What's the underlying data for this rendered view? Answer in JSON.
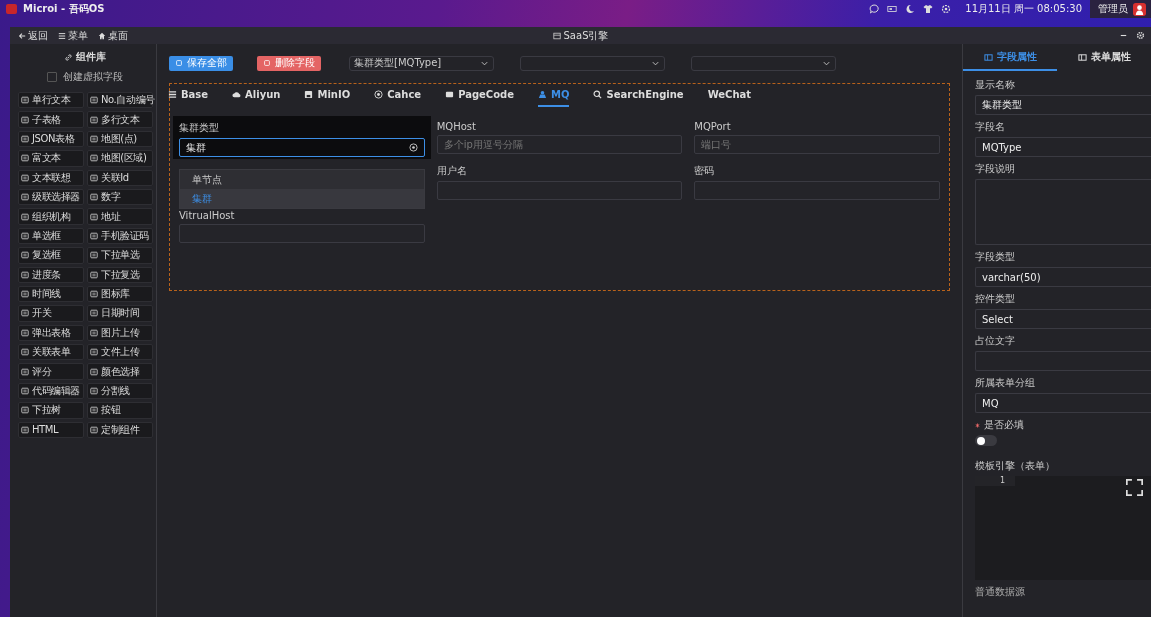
{
  "top_bar": {
    "app_title": "Microi - 吾码OS",
    "clock": "11月11日 周一 08:05:30",
    "user": "管理员"
  },
  "window": {
    "nav": [
      {
        "label": "返回"
      },
      {
        "label": "菜单"
      },
      {
        "label": "桌面"
      }
    ],
    "title": "SaaS引擎"
  },
  "palette": {
    "title": "组件库",
    "virtual_field": {
      "label": "创建虚拟字段",
      "checked": false
    },
    "items": [
      {
        "label": "单行文本"
      },
      {
        "label": "No.自动编号"
      },
      {
        "label": "子表格"
      },
      {
        "label": "多行文本"
      },
      {
        "label": "JSON表格"
      },
      {
        "label": "地图(点)"
      },
      {
        "label": "富文本"
      },
      {
        "label": "地图(区域)"
      },
      {
        "label": "文本联想"
      },
      {
        "label": "关联Id"
      },
      {
        "label": "级联选择器"
      },
      {
        "label": "数字"
      },
      {
        "label": "组织机构"
      },
      {
        "label": "地址"
      },
      {
        "label": "单选框"
      },
      {
        "label": "手机验证码"
      },
      {
        "label": "复选框"
      },
      {
        "label": "下拉单选"
      },
      {
        "label": "进度条"
      },
      {
        "label": "下拉复选"
      },
      {
        "label": "时间线"
      },
      {
        "label": "图标库"
      },
      {
        "label": "开关"
      },
      {
        "label": "日期时间"
      },
      {
        "label": "弹出表格"
      },
      {
        "label": "图片上传"
      },
      {
        "label": "关联表单"
      },
      {
        "label": "文件上传"
      },
      {
        "label": "评分"
      },
      {
        "label": "颜色选择"
      },
      {
        "label": "代码编辑器"
      },
      {
        "label": "分割线"
      },
      {
        "label": "下拉树"
      },
      {
        "label": "按钮"
      },
      {
        "label": "HTML"
      },
      {
        "label": "定制组件"
      }
    ]
  },
  "toolbar": {
    "buttons": [
      {
        "label": "保存全部",
        "kind": "primary"
      },
      {
        "label": "删除字段",
        "kind": "danger"
      }
    ],
    "selects": [
      {
        "kind": "select",
        "value": "集群类型[MQType]"
      },
      {
        "kind": "select"
      },
      {
        "kind": "select"
      }
    ]
  },
  "form": {
    "tabs": [
      {
        "label": "Base",
        "selected": false
      },
      {
        "label": "Aliyun",
        "selected": false
      },
      {
        "label": "MinIO",
        "selected": false
      },
      {
        "label": "Cahce",
        "selected": false
      },
      {
        "label": "PageCode",
        "selected": false
      },
      {
        "label": "MQ",
        "selected": true
      },
      {
        "label": "SearchEngine",
        "selected": false
      },
      {
        "label": "WeChat",
        "selected": false
      }
    ],
    "fields": [
      {
        "label": "集群类型",
        "kind": "select",
        "value": "集群",
        "focused": true,
        "expanded": true,
        "options": [
          {
            "label": "单节点",
            "selected": false
          },
          {
            "label": "集群",
            "selected": true
          }
        ]
      },
      {
        "label": "MQHost",
        "kind": "input",
        "placeholder": "多个ip用逗号分隔"
      },
      {
        "label": "MQPort",
        "kind": "input",
        "placeholder": "端口号"
      },
      {
        "label": "用户名",
        "kind": "input"
      },
      {
        "label": "密码",
        "kind": "input"
      },
      {
        "label": "VitrualHost",
        "kind": "input"
      }
    ]
  },
  "properties": {
    "tabs": [
      {
        "label": "字段属性",
        "selected": true
      },
      {
        "label": "表单属性",
        "selected": false
      }
    ],
    "fields": [
      {
        "label": "显示名称",
        "kind": "input",
        "value": "集群类型"
      },
      {
        "label": "字段名",
        "kind": "input",
        "value": "MQType"
      },
      {
        "label": "字段说明",
        "kind": "textarea"
      },
      {
        "label": "字段类型",
        "kind": "input",
        "value": "varchar(50)"
      },
      {
        "label": "控件类型",
        "kind": "input",
        "value": "Select"
      },
      {
        "label": "占位文字",
        "kind": "input"
      },
      {
        "label": "所属表单分组",
        "kind": "input",
        "value": "MQ"
      },
      {
        "label": "是否必填",
        "kind": "switch",
        "required": true,
        "on": false
      },
      {
        "label": "模板引擎（表单）",
        "kind": "code",
        "line_numbers": [
          "1"
        ]
      },
      {
        "label": "普通数据源",
        "kind": "section"
      }
    ]
  }
}
